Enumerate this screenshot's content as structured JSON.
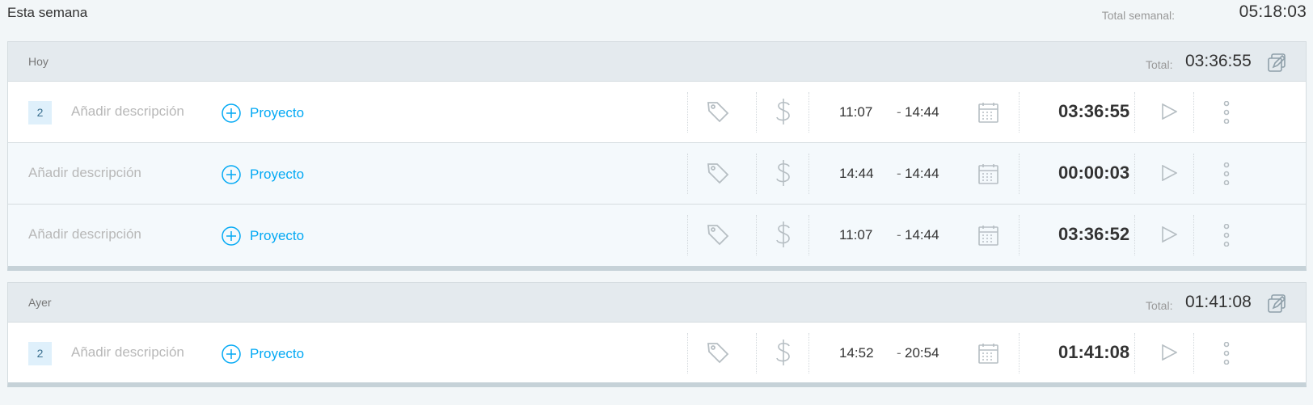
{
  "week": {
    "title": "Esta semana",
    "total_label": "Total semanal:",
    "total_value": "05:18:03"
  },
  "groups": [
    {
      "title": "Hoy",
      "total_label": "Total:",
      "total_value": "03:36:55",
      "entries": [
        {
          "count": "2",
          "description_placeholder": "Añadir descripción",
          "project_label": "Proyecto",
          "start": "11:07",
          "dash": "-",
          "end": "14:44",
          "duration": "03:36:55"
        },
        {
          "description_placeholder": "Añadir descripción",
          "project_label": "Proyecto",
          "start": "14:44",
          "dash": "-",
          "end": "14:44",
          "duration": "00:00:03"
        },
        {
          "description_placeholder": "Añadir descripción",
          "project_label": "Proyecto",
          "start": "11:07",
          "dash": "-",
          "end": "14:44",
          "duration": "03:36:52"
        }
      ]
    },
    {
      "title": "Ayer",
      "total_label": "Total:",
      "total_value": "01:41:08",
      "entries": [
        {
          "count": "2",
          "description_placeholder": "Añadir descripción",
          "project_label": "Proyecto",
          "start": "14:52",
          "dash": "-",
          "end": "20:54",
          "duration": "01:41:08"
        }
      ]
    }
  ],
  "colors": {
    "accent": "#03a9f4",
    "icon_grey": "#b6bec3",
    "header_bg": "#e4eaee",
    "child_row_bg": "#f4f9fc"
  },
  "icons": [
    "plus-circle-icon",
    "tag-icon",
    "dollar-icon",
    "calendar-icon",
    "play-icon",
    "more-vertical-icon",
    "bulk-edit-icon"
  ]
}
